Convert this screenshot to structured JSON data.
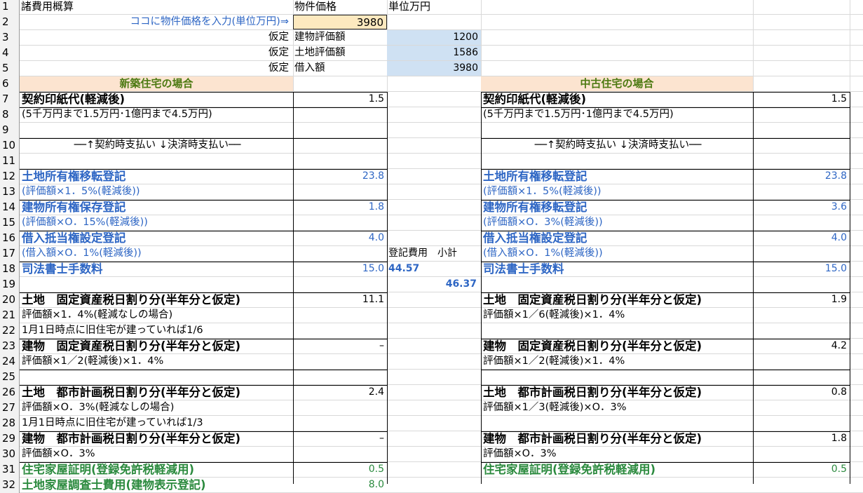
{
  "rows": [
    {
      "n": "1",
      "a": "諸費用概算",
      "b": "物件価格",
      "c": "単位万円"
    },
    {
      "n": "2",
      "a": "ココに物件価格を入力(単位万円)⇒",
      "b": "3980"
    },
    {
      "n": "3",
      "a": "仮定",
      "b": "建物評価額",
      "c": "1200"
    },
    {
      "n": "4",
      "a": "仮定",
      "b": "土地評価額",
      "c": "1586"
    },
    {
      "n": "5",
      "a": "仮定",
      "b": "借入額",
      "c": "3980"
    },
    {
      "n": "6",
      "a": "新築住宅の場合",
      "e": "中古住宅の場合"
    },
    {
      "n": "7",
      "a": "契約印紙代(軽減後)",
      "b": "1.5",
      "e": "契約印紙代(軽減後)",
      "f": "1.5"
    },
    {
      "n": "8",
      "a": "(5千万円まで1.5万円･1億円まで4.5万円)",
      "e": "(5千万円まで1.5万円･1億円まで4.5万円)"
    },
    {
      "n": "9"
    },
    {
      "n": "10",
      "a": "──↑契約時支払い ↓決済時支払い──",
      "e": "──↑契約時支払い ↓決済時支払い──"
    },
    {
      "n": "11"
    },
    {
      "n": "12",
      "a": "土地所有権移転登記",
      "b": "23.8",
      "e": "土地所有権移転登記",
      "f": "23.8"
    },
    {
      "n": "13",
      "a": "(評価額×1．5%(軽減後))",
      "e": "(評価額×1．5%(軽減後))"
    },
    {
      "n": "14",
      "a": "建物所有権保存登記",
      "b": "1.8",
      "e": "建物所有権移転登記",
      "f": "3.6"
    },
    {
      "n": "15",
      "a": "(評価額×O．15%(軽減後))",
      "e": "(評価額×O．3%(軽減後))"
    },
    {
      "n": "16",
      "a": "借入抵当権設定登記",
      "b": "4.0",
      "e": "借入抵当権設定登記",
      "f": "4.0"
    },
    {
      "n": "17",
      "a": "(借入額×O．1%(軽減後))",
      "c": "登記費用　小計",
      "e": "(借入額×O．1%(軽減後))"
    },
    {
      "n": "18",
      "a": "司法書士手数料",
      "b": "15.0",
      "c": "44.57",
      "e": "司法書士手数料",
      "f": "15.0"
    },
    {
      "n": "19",
      "c": "46.37"
    },
    {
      "n": "20",
      "a": "土地　固定資産税日割り分(半年分と仮定)",
      "b": "11.1",
      "e": "土地　固定資産税日割り分(半年分と仮定)",
      "f": "1.9"
    },
    {
      "n": "21",
      "a": "評価額×1．4%(軽減なしの場合)",
      "e": "評価額×1／6(軽減後)×1．4%"
    },
    {
      "n": "22",
      "a": "1月1日時点に旧住宅が建っていれば1/6"
    },
    {
      "n": "23",
      "a": "建物　固定資産税日割り分(半年分と仮定)",
      "b": "–",
      "e": "建物　固定資産税日割り分(半年分と仮定)",
      "f": "4.2"
    },
    {
      "n": "24",
      "a": "評価額×1／2(軽減後)×1．4%",
      "e": "評価額×1／2(軽減後)×1．4%"
    },
    {
      "n": "25"
    },
    {
      "n": "26",
      "a": "土地　都市計画税日割り分(半年分と仮定)",
      "b": "2.4",
      "e": "土地　都市計画税日割り分(半年分と仮定)",
      "f": "0.8"
    },
    {
      "n": "27",
      "a": "評価額×O．3%(軽減なしの場合)",
      "e": "評価額×1／3(軽減後)×O．3%"
    },
    {
      "n": "28",
      "a": "1月1日時点に旧住宅が建っていれば1/3"
    },
    {
      "n": "29",
      "a": "建物　都市計画税日割り分(半年分と仮定)",
      "b": "–",
      "e": "建物　都市計画税日割り分(半年分と仮定)",
      "f": "1.8"
    },
    {
      "n": "30",
      "a": "評価額×O．3%",
      "e": "評価額×O．3%"
    },
    {
      "n": "31",
      "a": "住宅家屋証明(登録免許税軽減用)",
      "b": "0.5",
      "e": "住宅家屋証明(登録免許税軽減用)",
      "f": "0.5"
    },
    {
      "n": "32",
      "a": "土地家屋調査士費用(建物表示登記)",
      "b": "8.0"
    }
  ],
  "colors": {
    "input_fill": "#fde9bf",
    "blue_fill": "#cfe1f3",
    "section_fill": "#fce4d0",
    "blue_text": "#2e66c4",
    "green_text": "#2b8a3e",
    "section_text": "#4d7a12",
    "subtotal_text": "#2e66c4"
  }
}
